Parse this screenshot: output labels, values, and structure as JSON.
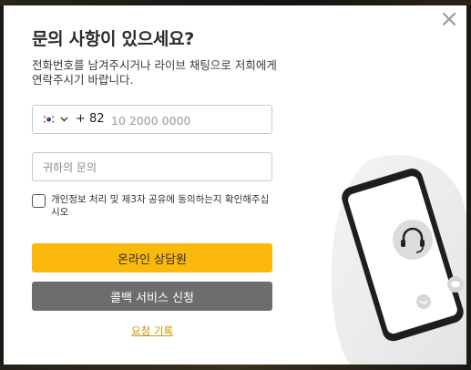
{
  "dialog": {
    "close_glyph": "×",
    "title": "문의 사항이 있으세요?",
    "description": "전화번호를 남겨주시거나 라이브 채팅으로 저희에게 연락주시기 바랍니다."
  },
  "phone": {
    "country_flag": "kr-flag-icon",
    "dial_code": "+ 82",
    "placeholder": "10 2000 0000",
    "value": ""
  },
  "inquiry": {
    "placeholder": "귀하의 문의",
    "value": ""
  },
  "consent": {
    "checked": false,
    "label": "개인정보 처리 및 제3자 공유에 동의하는지 확인해주십시오"
  },
  "buttons": {
    "online_consult": "온라인 상담원",
    "callback": "콜백 서비스 신청",
    "request_history": "요청 기록"
  },
  "colors": {
    "primary": "#fbb80d",
    "secondary": "#6d6d6d",
    "link": "#c8950a"
  },
  "icons": {
    "support": "headset-icon",
    "chat": "chat-bubble-icon",
    "emoji": "smiley-icon"
  }
}
